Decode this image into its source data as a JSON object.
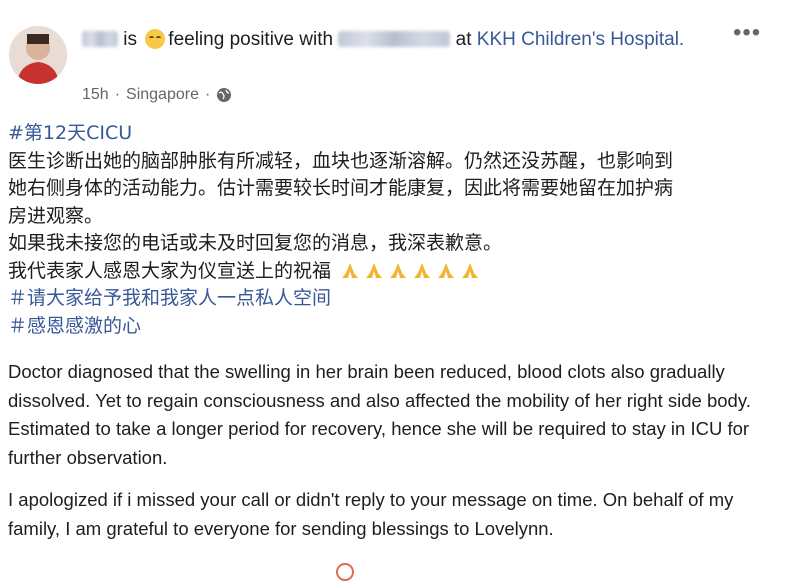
{
  "post": {
    "author_name": "",
    "header_is": "is",
    "header_feeling": "feeling positive with",
    "header_at": "at",
    "location_link": "KKH Children's Hospital.",
    "time": "15h",
    "separator": "·",
    "place": "Singapore",
    "separator2": "·",
    "more_label": "•••",
    "zh_lines": [
      "#第12天CICU",
      "医生诊断出她的脑部肿胀有所减轻，血块也逐渐溶解。仍然还没苏醒，也影响到",
      "她右侧身体的活动能力。估计需要较长时间才能康复，因此将需要她留在加护病",
      "房进观察。",
      "如果我未接您的电话或未及时回复您的消息，我深表歉意。",
      "我代表家人感恩大家为仪宣送上的祝福",
      "＃请大家给予我和我家人一点私人空间",
      "＃感恩感激的心"
    ],
    "en_paragraphs": [
      "Doctor diagnosed that the swelling in her brain been reduced, blood clots also gradually dissolved. Yet to regain consciousness and also affected the mobility of her right side body. Estimated to take a longer period for recovery, hence she will be required to stay in ICU for further observation.",
      "I apologized if i missed your call or didn't reply to your message on time. On behalf of my family, I am grateful to everyone for sending blessings to Lovelynn."
    ],
    "icons": {
      "feeling": "smiling-face-icon",
      "privacy": "globe-icon",
      "pray": "folded-hands-icon"
    },
    "colors": {
      "link": "#385898",
      "meta": "#606770",
      "text": "#1c1e21"
    }
  }
}
